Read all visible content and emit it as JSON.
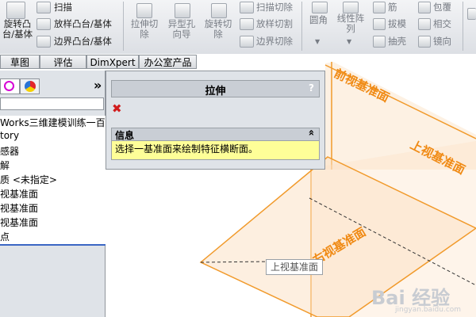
{
  "ribbon": {
    "revolve_boss": "旋转凸\n台/基体",
    "scan": "扫描",
    "lofted_boss": "放样凸台/基体",
    "boundary_boss": "边界凸台/基体",
    "extruded_cut": "拉伸切\n除",
    "hole_wizard": "异型孔\n向导",
    "revolved_cut": "旋转切\n除",
    "swept_cut": "扫描切除",
    "lofted_cut": "放样切割",
    "boundary_cut": "边界切除",
    "fillet": "圆角",
    "linear_pattern": "线性阵\n列",
    "rib": "筋",
    "draft": "拔模",
    "shell": "抽壳",
    "wrap": "包覆",
    "intersect": "相交",
    "mirror": "镜向"
  },
  "tabs": [
    "草图",
    "评估",
    "DimXpert",
    "办公室产品"
  ],
  "left_panel": {
    "collapse_glyph": "»",
    "tree_items": [
      "Works三维建模训练一百七",
      "tory",
      "感器",
      "解",
      "质 <未指定>",
      "视基准面",
      "视基准面",
      "视基准面",
      "点"
    ]
  },
  "property_manager": {
    "title": "拉伸",
    "help": "?",
    "cancel_glyph": "✖",
    "section_title": "信息",
    "section_toggle": "«",
    "message": "选择一基准面来绘制特征横断面。"
  },
  "viewport": {
    "front_plane": "前视基准面",
    "top_plane": "上视基准面",
    "right_plane": "右视基准面",
    "tooltip": "上视基准面",
    "watermark": "Bai 经验",
    "watermark_url": "jingyan.baidu.com"
  },
  "colors": {
    "plane_stroke": "#f19a2b",
    "plane_fill": "#fbe0c2",
    "plane_text": "#f08a14",
    "message_bg": "#fefe98",
    "header_bg": "#c9ced5",
    "cancel_red": "#d11d1d"
  }
}
